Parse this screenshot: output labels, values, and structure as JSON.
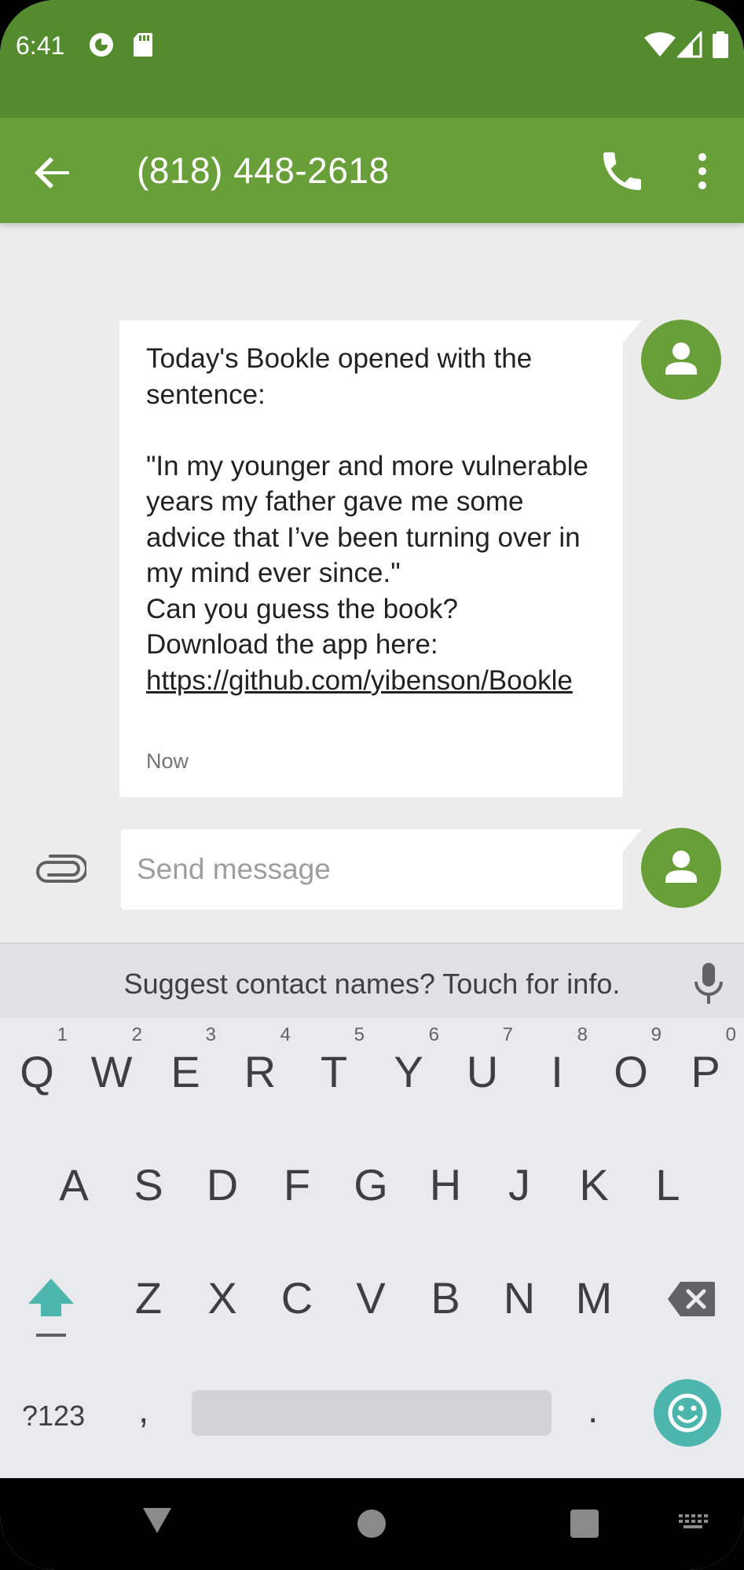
{
  "status_bar": {
    "time": "6:41",
    "icons": [
      "sync-app-icon",
      "sd-card-icon",
      "wifi-icon",
      "cellular-signal-icon",
      "battery-icon"
    ]
  },
  "app_bar": {
    "title": "(818) 448-2618",
    "back_icon": "arrow-back-icon",
    "call_icon": "phone-icon",
    "more_icon": "more-vert-icon"
  },
  "conversation": {
    "message": {
      "text_before_link": "Today's Bookle opened with the sentence:\n\n\"In my younger and more vulnerable years my father gave me some advice that I’ve been turning over in my mind ever since.\"\nCan you guess the book?\nDownload the app here: ",
      "link": "https://github.com/yibenson/Bookle",
      "timestamp": "Now"
    }
  },
  "compose": {
    "placeholder": "Send message",
    "attach_icon": "paperclip-icon"
  },
  "keyboard": {
    "suggestion": "Suggest contact names? Touch for info.",
    "row1": [
      {
        "label": "Q",
        "hint": "1"
      },
      {
        "label": "W",
        "hint": "2"
      },
      {
        "label": "E",
        "hint": "3"
      },
      {
        "label": "R",
        "hint": "4"
      },
      {
        "label": "T",
        "hint": "5"
      },
      {
        "label": "Y",
        "hint": "6"
      },
      {
        "label": "U",
        "hint": "7"
      },
      {
        "label": "I",
        "hint": "8"
      },
      {
        "label": "O",
        "hint": "9"
      },
      {
        "label": "P",
        "hint": "0"
      }
    ],
    "row2": [
      "A",
      "S",
      "D",
      "F",
      "G",
      "H",
      "J",
      "K",
      "L"
    ],
    "row3": [
      "Z",
      "X",
      "C",
      "V",
      "B",
      "N",
      "M"
    ],
    "symbols_label": "?123",
    "comma_label": ",",
    "period_label": "."
  },
  "colors": {
    "status_bar": "#558b2f",
    "app_bar": "#689f38",
    "avatar": "#689f38",
    "emoji_key": "#4db6ac",
    "shift_icon": "#4db6ac"
  }
}
